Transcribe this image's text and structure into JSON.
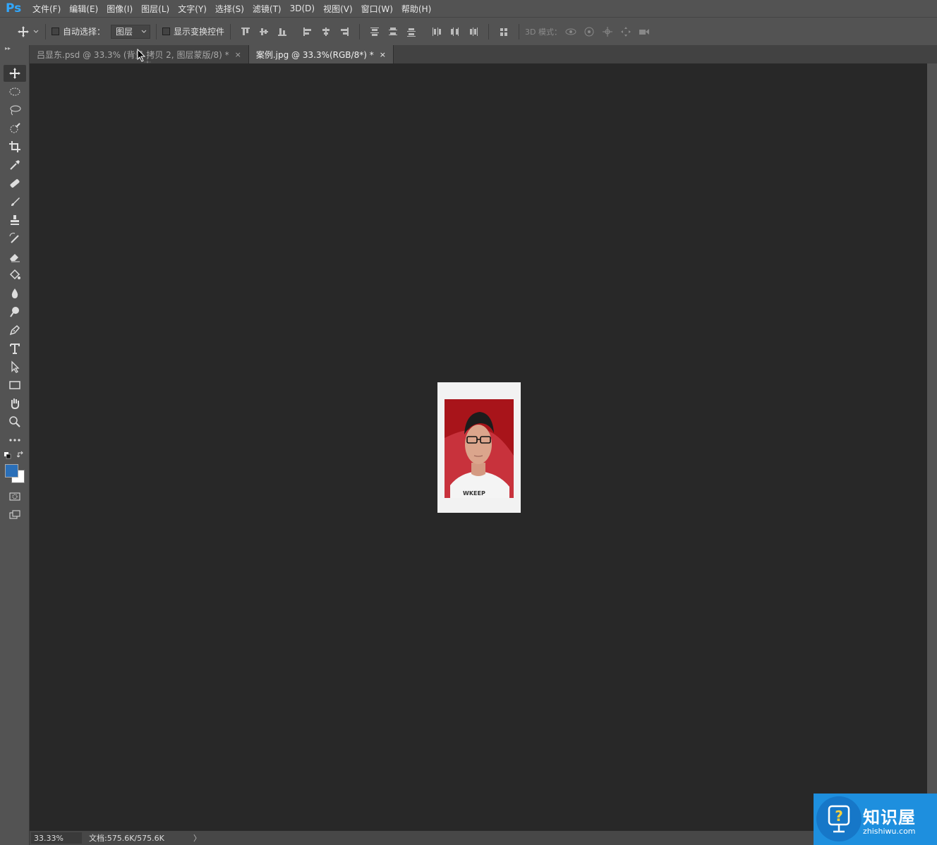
{
  "app": {
    "logo": "Ps"
  },
  "menu": [
    "文件(F)",
    "编辑(E)",
    "图像(I)",
    "图层(L)",
    "文字(Y)",
    "选择(S)",
    "滤镜(T)",
    "3D(D)",
    "视图(V)",
    "窗口(W)",
    "帮助(H)"
  ],
  "options": {
    "auto_select_label": "自动选择：",
    "auto_select_value": "图层",
    "show_transform_label": "显示变换控件",
    "mode_3d_label": "3D 模式："
  },
  "tabs": [
    {
      "label": "吕显东.psd @ 33.3% (背景 拷贝 2, 图层蒙版/8) *",
      "close": "×"
    },
    {
      "label": "案例.jpg @ 33.3%(RGB/8*) *",
      "close": "×"
    }
  ],
  "status": {
    "zoom": "33.33%",
    "doc_info": "文档:575.6K/575.6K",
    "arrow": "〉"
  },
  "watermark": {
    "title": "知识屋",
    "subtitle": "zhishiwu.com"
  },
  "colors": {
    "foreground": "#2a6fb8",
    "background": "#ffffff",
    "photo_bg": "#a8141a"
  }
}
